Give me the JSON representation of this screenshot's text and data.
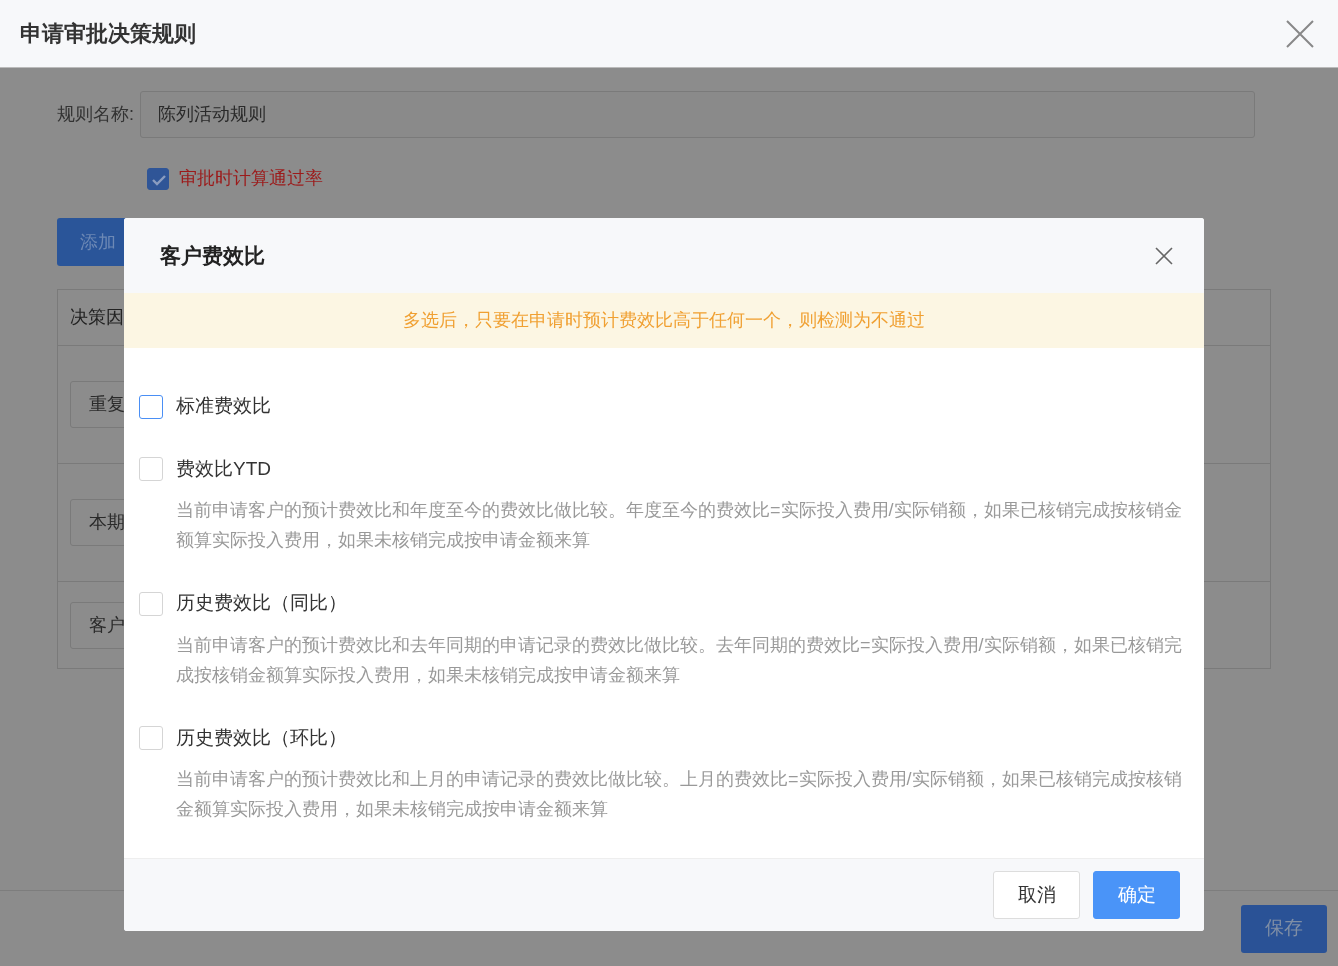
{
  "page": {
    "title": "申请审批决策规则",
    "rule_name_label": "规则名称:",
    "rule_name_value": "陈列活动规则",
    "pass_rate_checkbox": {
      "label": "审批时计算通过率",
      "checked": true
    },
    "add_button": "添加",
    "table_header": "决策因",
    "rows": [
      "重复",
      "本期",
      "客户"
    ],
    "save_button": "保存"
  },
  "dialog": {
    "title": "客户费效比",
    "notice": "多选后，只要在申请时预计费效比高于任何一个，则检测为不通过",
    "options": [
      {
        "label": "标准费效比",
        "checked": false,
        "focused": true
      },
      {
        "label": "费效比YTD",
        "checked": false,
        "focused": false,
        "description": "当前申请客户的预计费效比和年度至今的费效比做比较。年度至今的费效比=实际投入费用/实际销额，如果已核销完成按核销金额算实际投入费用，如果未核销完成按申请金额来算"
      },
      {
        "label": "历史费效比（同比）",
        "checked": false,
        "focused": false,
        "description": "当前申请客户的预计费效比和去年同期的申请记录的费效比做比较。去年同期的费效比=实际投入费用/实际销额，如果已核销完成按核销金额算实际投入费用，如果未核销完成按申请金额来算"
      },
      {
        "label": "历史费效比（环比）",
        "checked": false,
        "focused": false,
        "description": "当前申请客户的预计费效比和上月的申请记录的费效比做比较。上月的费效比=实际投入费用/实际销额，如果已核销完成按核销金额算实际投入费用，如果未核销完成按申请金额来算"
      }
    ],
    "buttons": [
      {
        "label": "取消",
        "kind": "default"
      },
      {
        "label": "确定",
        "kind": "primary"
      }
    ]
  }
}
